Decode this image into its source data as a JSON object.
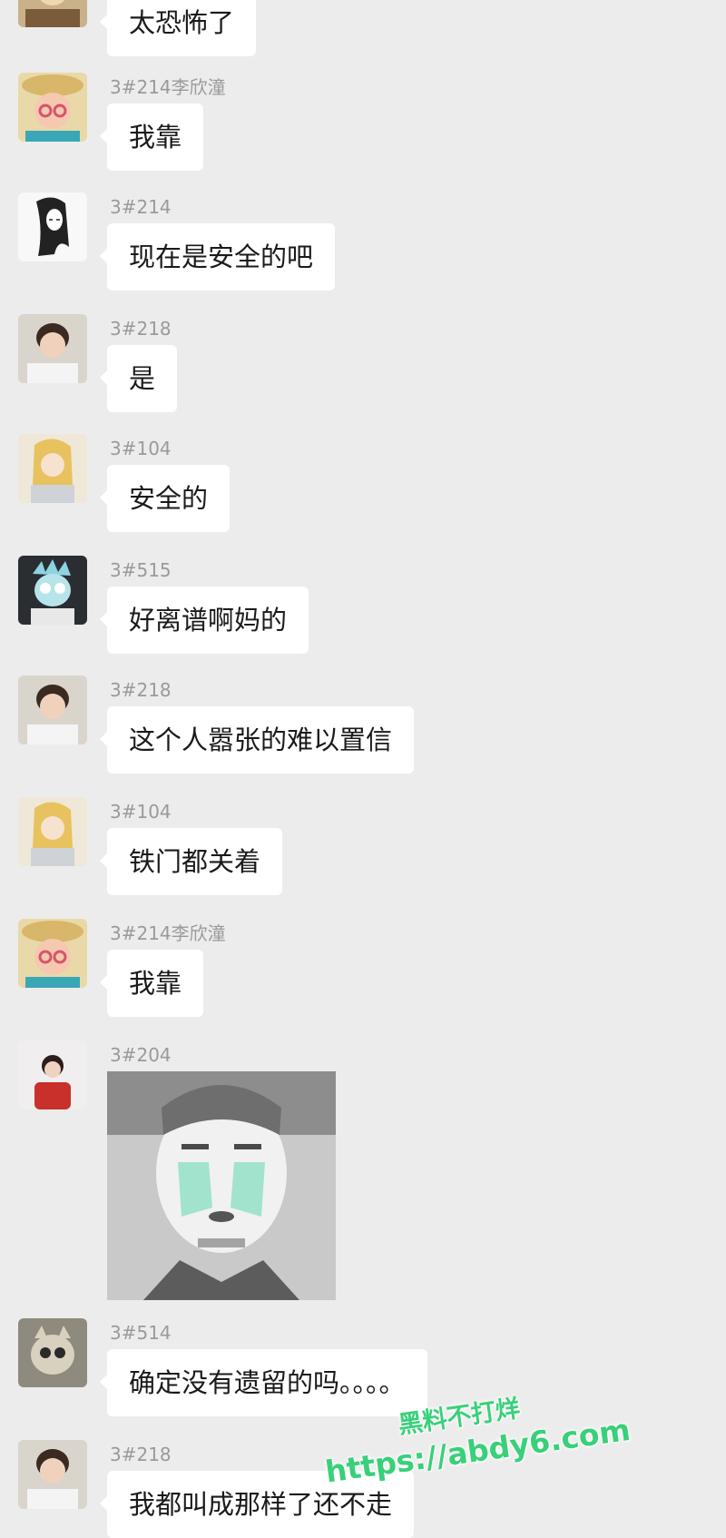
{
  "messages": [
    {
      "sender": "",
      "text": "太恐怖了",
      "avatar": "cartoon-avatar"
    },
    {
      "sender": "3#214李欣潼",
      "text": "我靠",
      "avatar": "girl-hat-avatar"
    },
    {
      "sender": "3#214",
      "text": "现在是安全的吧",
      "avatar": "sketch-woman-avatar"
    },
    {
      "sender": "3#218",
      "text": "是",
      "avatar": "person-photo-avatar"
    },
    {
      "sender": "3#104",
      "text": "安全的",
      "avatar": "anime-girl-avatar"
    },
    {
      "sender": "3#515",
      "text": "好离谱啊妈的",
      "avatar": "rick-cartoon-avatar"
    },
    {
      "sender": "3#218",
      "text": "这个人嚣张的难以置信",
      "avatar": "person-photo-avatar"
    },
    {
      "sender": "3#104",
      "text": "铁门都关着",
      "avatar": "anime-girl-avatar"
    },
    {
      "sender": "3#214李欣潼",
      "text": "我靠",
      "avatar": "girl-hat-avatar"
    },
    {
      "sender": "3#204",
      "text": "",
      "avatar": "red-shirt-person-avatar",
      "sticker": "crying-meme-sticker"
    },
    {
      "sender": "3#514",
      "text": "确定没有遗留的吗。。。。",
      "avatar": "creature-avatar"
    },
    {
      "sender": "3#218",
      "text": "我都叫成那样了还不走",
      "avatar": "person-photo-avatar"
    }
  ],
  "watermark": {
    "line1": "黑料不打烊",
    "line2": "https://abdy6.com",
    "color": "#39d07a"
  },
  "colors": {
    "background": "#ececec",
    "bubble": "#ffffff",
    "sender_text": "#9a9a9a"
  }
}
